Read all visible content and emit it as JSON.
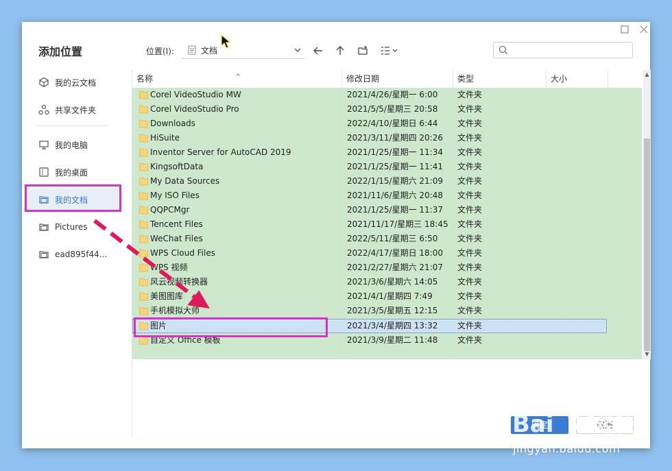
{
  "dialog": {
    "title": "添加位置",
    "location_label": "位置(I):",
    "location_value": "文档",
    "search_placeholder": ""
  },
  "sidebar": {
    "items": [
      {
        "label": "我的云文档",
        "icon": "cloud-doc-icon"
      },
      {
        "label": "共享文件夹",
        "icon": "share-folder-icon"
      },
      {
        "label": "我的电脑",
        "icon": "computer-icon"
      },
      {
        "label": "我的桌面",
        "icon": "desktop-icon"
      },
      {
        "label": "我的文档",
        "icon": "documents-icon",
        "active": true
      },
      {
        "label": "Pictures",
        "icon": "folder-icon"
      },
      {
        "label": "ead895f44...",
        "icon": "folder-icon"
      }
    ]
  },
  "columns": {
    "name": "名称",
    "date": "修改日期",
    "type": "类型",
    "size": "大小"
  },
  "files": [
    {
      "name": "Corel VideoStudio MW",
      "date": "2021/4/26/星期一 6:00",
      "type": "文件夹"
    },
    {
      "name": "Corel VideoStudio Pro",
      "date": "2021/5/5/星期三 20:58",
      "type": "文件夹"
    },
    {
      "name": "Downloads",
      "date": "2022/4/10/星期日 6:44",
      "type": "文件夹"
    },
    {
      "name": "HiSuite",
      "date": "2021/3/11/星期四 20:26",
      "type": "文件夹"
    },
    {
      "name": "Inventor Server for AutoCAD 2019",
      "date": "2021/1/25/星期一 11:34",
      "type": "文件夹"
    },
    {
      "name": "KingsoftData",
      "date": "2021/1/25/星期一 11:41",
      "type": "文件夹"
    },
    {
      "name": "My Data Sources",
      "date": "2022/1/15/星期六 21:09",
      "type": "文件夹"
    },
    {
      "name": "My ISO Files",
      "date": "2021/11/6/星期六 20:48",
      "type": "文件夹"
    },
    {
      "name": "QQPCMgr",
      "date": "2021/1/25/星期一 11:37",
      "type": "文件夹"
    },
    {
      "name": "Tencent Files",
      "date": "2021/11/17/星期三 18:45",
      "type": "文件夹"
    },
    {
      "name": "WeChat Files",
      "date": "2022/5/11/星期三 6:50",
      "type": "文件夹"
    },
    {
      "name": "WPS Cloud Files",
      "date": "2022/4/17/星期日 18:00",
      "type": "文件夹"
    },
    {
      "name": "WPS 视频",
      "date": "2021/2/27/星期六 21:07",
      "type": "文件夹"
    },
    {
      "name": "风云视频转换器",
      "date": "2021/3/6/星期六 14:05",
      "type": "文件夹"
    },
    {
      "name": "美图图库",
      "date": "2021/4/1/星期四 7:49",
      "type": "文件夹"
    },
    {
      "name": "手机模拟大师",
      "date": "2021/3/5/星期五 12:15",
      "type": "文件夹"
    },
    {
      "name": "图片",
      "date": "2021/3/4/星期四 13:32",
      "type": "文件夹",
      "selected": true
    },
    {
      "name": "自定义 Office 模板",
      "date": "2021/3/9/星期二 11:48",
      "type": "文件夹"
    }
  ],
  "buttons": {
    "ok": "确定",
    "cancel": "取消"
  },
  "watermark": {
    "url": "jingyan.baidu.com"
  },
  "colors": {
    "accent": "#3a7bd5",
    "highlight": "#d532c8",
    "row_background": "#cde8cc",
    "folder": "#f6d67a"
  }
}
